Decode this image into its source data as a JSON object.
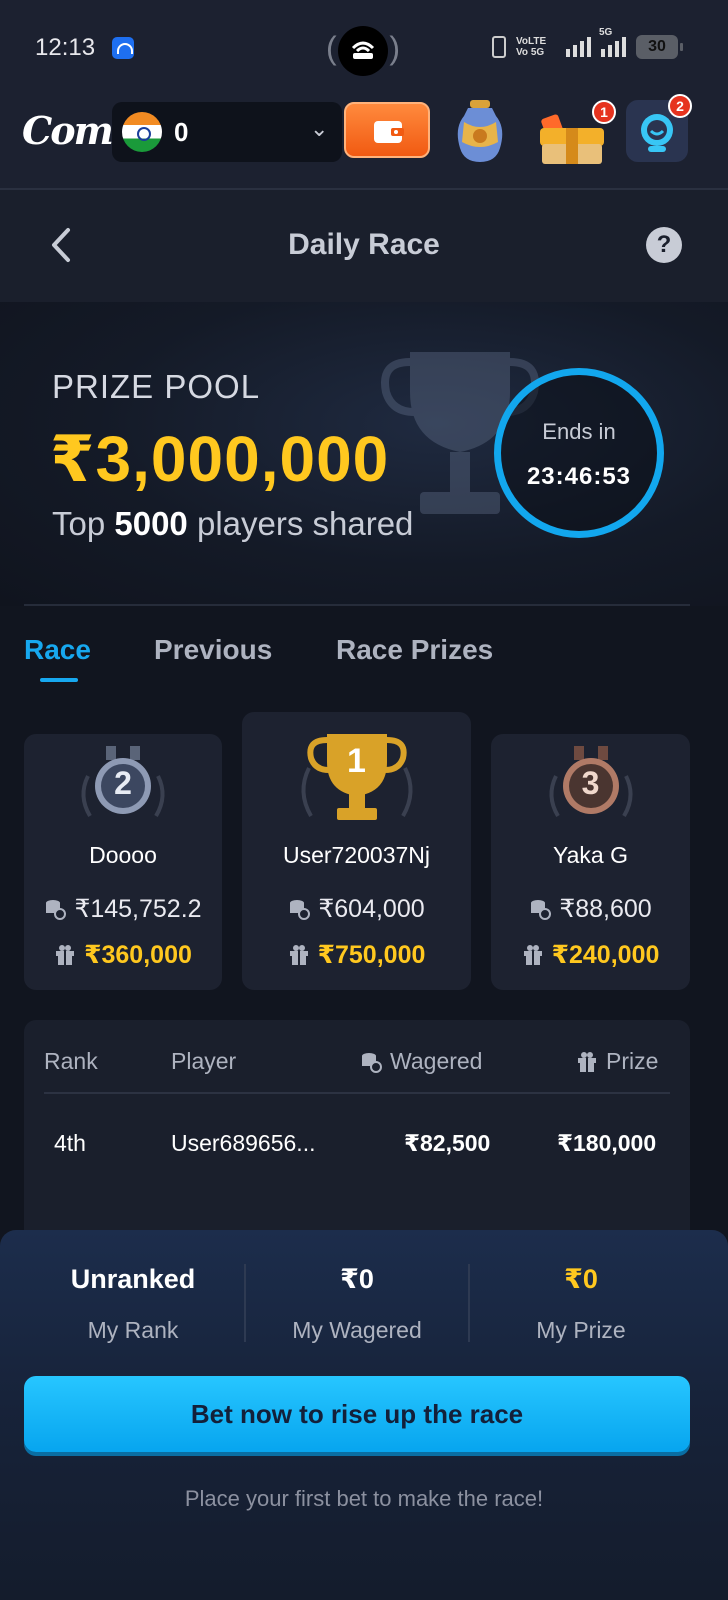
{
  "status_bar": {
    "time": "12:13",
    "volte_line1": "VoLTE",
    "volte_line2": "Vo 5G",
    "network": "5G",
    "battery": "30"
  },
  "header": {
    "logo": "Come",
    "balance": "0",
    "currency_flag": "india-flag-icon",
    "gift_badge": "1",
    "support_badge": "2"
  },
  "page": {
    "title": "Daily Race",
    "help": "?"
  },
  "hero": {
    "prize_pool_label": "PRIZE POOL",
    "prize_pool_amount": "₹3,000,000",
    "sub_prefix": "Top ",
    "sub_count": "5000",
    "sub_suffix": " players shared",
    "ends_in_label": "Ends in",
    "countdown": "23:46:53"
  },
  "tabs": [
    {
      "label": "Race",
      "active": true
    },
    {
      "label": "Previous",
      "active": false
    },
    {
      "label": "Race Prizes",
      "active": false
    }
  ],
  "podium": [
    {
      "rank": "2",
      "name": "Doooo",
      "wagered": "₹145,752.2",
      "prize": "₹360,000"
    },
    {
      "rank": "1",
      "name": "User720037Nj",
      "wagered": "₹604,000",
      "prize": "₹750,000"
    },
    {
      "rank": "3",
      "name": "Yaka G",
      "wagered": "₹88,600",
      "prize": "₹240,000"
    }
  ],
  "table": {
    "headers": {
      "rank": "Rank",
      "player": "Player",
      "wagered": "Wagered",
      "prize": "Prize"
    },
    "rows": [
      {
        "rank": "4th",
        "player": "User689656...",
        "wagered": "₹82,500",
        "prize": "₹180,000"
      }
    ]
  },
  "my_stats": {
    "rank_value": "Unranked",
    "rank_label": "My Rank",
    "wagered_value": "₹0",
    "wagered_label": "My Wagered",
    "prize_value": "₹0",
    "prize_label": "My Prize"
  },
  "cta": {
    "button_label": "Bet now to rise up the race",
    "hint": "Place your first bet to make the race!"
  },
  "colors": {
    "accent": "#17a8ef",
    "gold": "#ffc81f",
    "background": "#11151f",
    "wallet": "#f15a12"
  }
}
